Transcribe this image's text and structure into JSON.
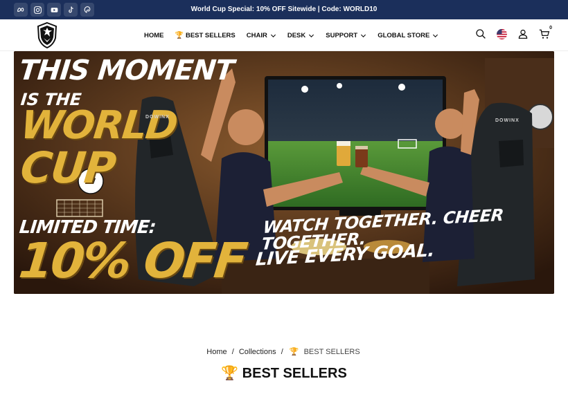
{
  "announcement": {
    "text": "World Cup Special: 10% OFF Sitewide | Code: WORLD10",
    "bg_color": "#1b2f5b"
  },
  "social_links": [
    "meta-icon",
    "instagram-icon",
    "youtube-icon",
    "tiktok-icon",
    "pinterest-icon"
  ],
  "nav": {
    "items": [
      {
        "label": "HOME",
        "has_dropdown": false
      },
      {
        "label": "BEST SELLERS",
        "icon": "🏆",
        "has_dropdown": false
      },
      {
        "label": "CHAIR",
        "has_dropdown": true
      },
      {
        "label": "DESK",
        "has_dropdown": true
      },
      {
        "label": "SUPPORT",
        "has_dropdown": true
      },
      {
        "label": "GLOBAL STORE",
        "has_dropdown": true
      }
    ]
  },
  "header_icons": {
    "search": "search-icon",
    "region": "us-flag-icon",
    "account": "user-icon",
    "cart": "cart-icon",
    "cart_count": "0"
  },
  "hero": {
    "line1": "THIS MOMENT",
    "line2": "IS THE",
    "line3": "WORLD",
    "line4": "CUP",
    "limited": "LIMITED TIME:",
    "discount": "10% OFF",
    "tagline1": "WATCH TOGETHER. CHEER TOGETHER.",
    "tagline2": "LIVE EVERY GOAL.",
    "chair_brand": "DOWINX",
    "accent_color": "#e2b33b"
  },
  "breadcrumb": {
    "home": "Home",
    "separator": "/",
    "collections": "Collections",
    "current_icon": "🏆",
    "current": "BEST SELLERS"
  },
  "page_title": {
    "icon": "🏆",
    "text": "BEST SELLERS"
  }
}
